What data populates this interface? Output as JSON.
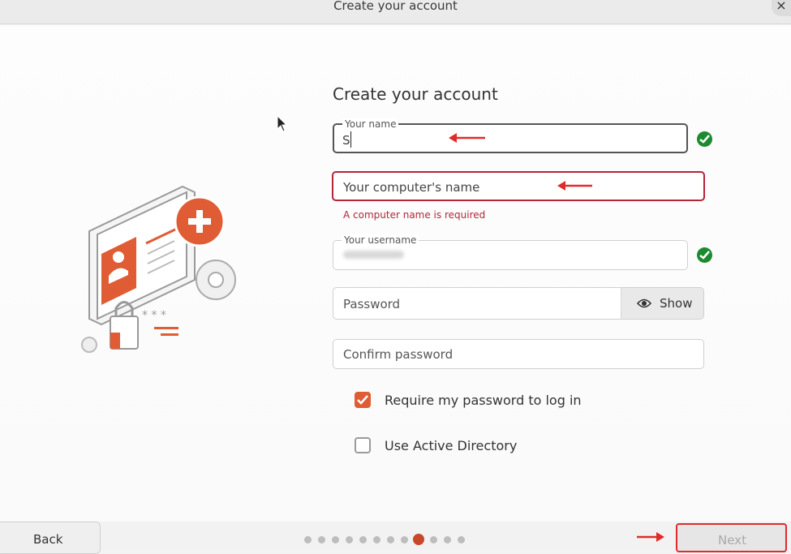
{
  "window": {
    "title": "Create your account",
    "close_glyph": "×"
  },
  "form": {
    "heading": "Create your account",
    "name_field": {
      "label": "Your name",
      "value": "S"
    },
    "computer_field": {
      "placeholder": "Your computer's name",
      "error": "A computer name is required"
    },
    "username_field": {
      "label": "Your username"
    },
    "password_field": {
      "placeholder": "Password",
      "show_label": "Show"
    },
    "confirm_field": {
      "placeholder": "Confirm password"
    },
    "require_password": {
      "label": "Require my password to log in",
      "checked": true
    },
    "active_directory": {
      "label": "Use Active Directory",
      "checked": false
    }
  },
  "nav": {
    "back_label": "Back",
    "next_label": "Next",
    "steps_total": 12,
    "current_step": 9
  },
  "icons": [
    "check-icon",
    "eye-icon",
    "checkbox-check-icon",
    "cursor-icon",
    "red-arrow-annotation"
  ],
  "colors": {
    "accent": "#e05c35",
    "error": "#b3263a",
    "success": "#1a8b2f",
    "annotation": "#e02b2b"
  }
}
